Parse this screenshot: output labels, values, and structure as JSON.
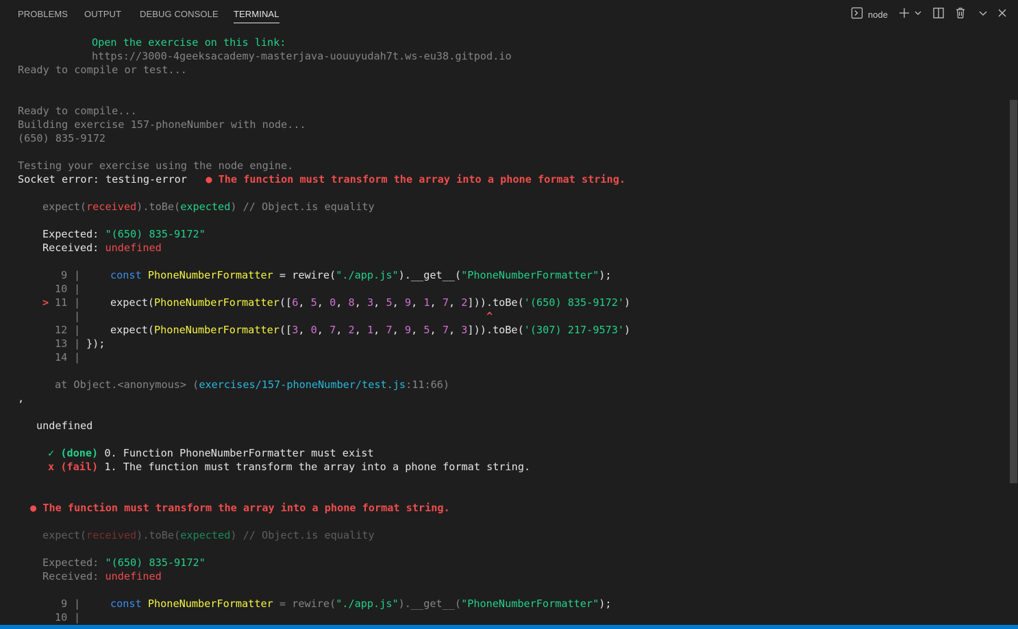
{
  "panel": {
    "tabs": [
      {
        "label": "PROBLEMS"
      },
      {
        "label": "OUTPUT"
      },
      {
        "label": "DEBUG CONSOLE"
      },
      {
        "label": "TERMINAL"
      }
    ],
    "terminal_name": "node"
  },
  "colors": {
    "accent": "#007acc",
    "green": "#23d18b",
    "red": "#f14c4c",
    "yellow": "#f5f543",
    "blue": "#3b8eea",
    "cyan": "#29b8db",
    "magenta": "#d670d6"
  },
  "icons": [
    "terminal-icon",
    "plus-icon",
    "chevron-down-icon",
    "split-icon",
    "trash-icon",
    "chevron-down-icon",
    "close-icon"
  ],
  "terminal": {
    "open_label": "Open the exercise on this link:",
    "url": "https://3000-4geeksacademy-masterjava-uouuyudah7t.ws-eu38.gitpod.io",
    "ready_compile_or_test": "Ready to compile or test...",
    "ready_compile": "Ready to compile...",
    "building": "Building exercise 157-phoneNumber with node...",
    "output_value": "(650) 835-9172",
    "testing": "Testing your exercise using the node engine.",
    "socket_error": "Socket error: testing-error",
    "bullet": "●",
    "failure_message": "The function must transform the array into a phone format string.",
    "expect_line": {
      "expect": "expect(",
      "received": "received",
      "tobe": ").toBe(",
      "expected": "expected",
      "comment": ") // Object.is equality"
    },
    "expected_label": "Expected:",
    "expected_value": "\"(650) 835-9172\"",
    "received_label": "Received:",
    "received_value": "undefined",
    "code": {
      "ln9": "9",
      "ln10": "10",
      "ln11": "11",
      "ln12": "12",
      "ln13": "13",
      "ln14": "14",
      "marker": ">",
      "bar": "|",
      "const_kw": "const",
      "formatter_name": "PhoneNumberFormatter",
      "assign": " = rewire(",
      "path_str": "\"./app.js\"",
      "get_call": ").__get__(",
      "name_str": "\"PhoneNumberFormatter\"",
      "close_paren": ");",
      "expect_kw": "expect(",
      "arr1": [
        "6",
        "5",
        "0",
        "8",
        "3",
        "5",
        "9",
        "1",
        "7",
        "2"
      ],
      "arr2": [
        "3",
        "0",
        "7",
        "2",
        "1",
        "7",
        "9",
        "5",
        "7",
        "3"
      ],
      "tobe_call": ".toBe(",
      "str1": "'(650) 835-9172'",
      "str2": "'(307) 217-9573'",
      "caret": "^",
      "closing": "});"
    },
    "at_prefix": "at Object.<anonymous> (",
    "at_path": "exercises/157-phoneNumber/test.js",
    "at_suffix": ":11:66)",
    "comma": ",",
    "undefined_line": "undefined",
    "check_mark": "✓",
    "done_label": "(done)",
    "done_text": "0. Function PhoneNumberFormatter must exist",
    "x_mark": "x",
    "fail_label": "(fail)",
    "fail_text": "1. The function must transform the array into a phone format string."
  }
}
